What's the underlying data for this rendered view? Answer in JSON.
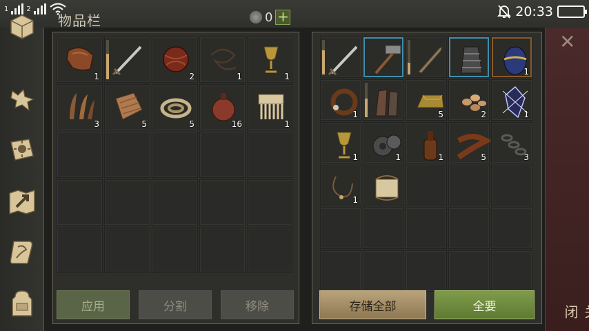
{
  "status_bar": {
    "sim1": "1",
    "sim2": "2",
    "time": "20:33"
  },
  "header": {
    "title": "物品栏",
    "coin_count": "0",
    "plus_label": "+"
  },
  "sidebar": {
    "items": [
      {
        "name": "inventory",
        "icon": "chest-icon"
      },
      {
        "name": "companion",
        "icon": "wolf-icon"
      },
      {
        "name": "skills",
        "icon": "sun-book-icon"
      },
      {
        "name": "map",
        "icon": "map-icon"
      },
      {
        "name": "quests",
        "icon": "scroll-icon"
      },
      {
        "name": "character",
        "icon": "backpack-icon"
      }
    ]
  },
  "left_panel": {
    "items": [
      {
        "name": "leather",
        "icon": "leather-icon",
        "qty": "1"
      },
      {
        "name": "sword",
        "icon": "sword-icon",
        "qty": "",
        "durability": 0.65
      },
      {
        "name": "wrapped-ball",
        "icon": "wrapped-ball-icon",
        "qty": "2"
      },
      {
        "name": "cord",
        "icon": "cord-icon",
        "qty": "1"
      },
      {
        "name": "goblet",
        "icon": "goblet-icon",
        "qty": "1"
      },
      {
        "name": "feathers",
        "icon": "feathers-icon",
        "qty": "3"
      },
      {
        "name": "cloth",
        "icon": "cloth-icon",
        "qty": "5"
      },
      {
        "name": "rope",
        "icon": "rope-icon",
        "qty": "5"
      },
      {
        "name": "flask",
        "icon": "flask-icon",
        "qty": "16"
      },
      {
        "name": "comb",
        "icon": "comb-icon",
        "qty": "1"
      }
    ],
    "apply_label": "应用",
    "split_label": "分割",
    "remove_label": "移除"
  },
  "right_panel": {
    "items": [
      {
        "name": "sword",
        "icon": "sword-icon",
        "qty": "",
        "durability": 0.7
      },
      {
        "name": "hammer",
        "icon": "hammer-icon",
        "qty": "",
        "highlight": "blue"
      },
      {
        "name": "dagger",
        "icon": "dagger-icon",
        "qty": "",
        "durability": 0.35
      },
      {
        "name": "gauntlet",
        "icon": "gauntlet-icon",
        "qty": "",
        "highlight": "blue"
      },
      {
        "name": "egg",
        "icon": "egg-icon",
        "qty": "1",
        "highlight": "orange"
      },
      {
        "name": "collar",
        "icon": "collar-icon",
        "qty": "1"
      },
      {
        "name": "gloves",
        "icon": "gloves-icon",
        "qty": "",
        "durability": 0.55
      },
      {
        "name": "ingot",
        "icon": "ingot-icon",
        "qty": "5"
      },
      {
        "name": "seeds",
        "icon": "seeds-icon",
        "qty": "2"
      },
      {
        "name": "crystal",
        "icon": "crystal-icon",
        "qty": "1"
      },
      {
        "name": "goblet",
        "icon": "goblet-icon",
        "qty": "1"
      },
      {
        "name": "gears",
        "icon": "gears-icon",
        "qty": "1"
      },
      {
        "name": "bottle",
        "icon": "bottle-icon",
        "qty": "1"
      },
      {
        "name": "leather-strap",
        "icon": "strap-icon",
        "qty": "5"
      },
      {
        "name": "chain",
        "icon": "chain-icon",
        "qty": "3"
      },
      {
        "name": "necklace",
        "icon": "necklace-icon",
        "qty": "1"
      },
      {
        "name": "scroll",
        "icon": "scroll-bundle-icon",
        "qty": ""
      }
    ],
    "store_all_label": "存储全部",
    "take_all_label": "全要"
  },
  "close_label": "关闭",
  "colors": {
    "accent_green": "#6f8c40",
    "accent_gold": "#a89069",
    "highlight_blue": "#3d8fb0",
    "highlight_orange": "#8a5a2a"
  }
}
